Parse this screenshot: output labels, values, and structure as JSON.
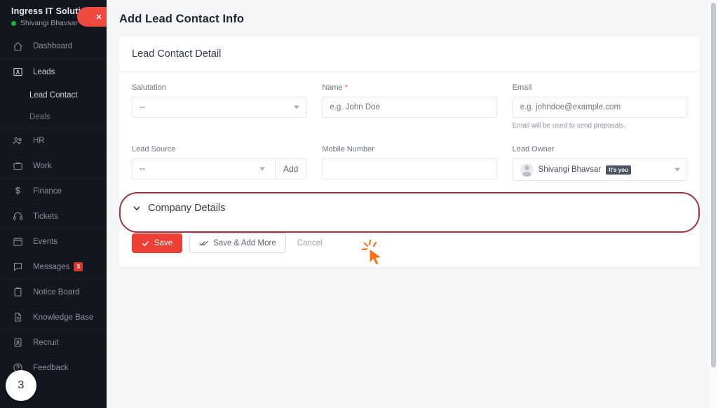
{
  "sidebar": {
    "profile": {
      "company": "Ingress IT Soluti...",
      "user": "Shivangi Bhavsar",
      "status_color": "#17b13f",
      "close_label": "✕",
      "close_color": "#f04a40"
    },
    "items": [
      {
        "label": "Dashboard",
        "icon": "home-icon",
        "active": false
      },
      {
        "label": "Leads",
        "icon": "leads-icon",
        "active": true
      },
      {
        "label": "HR",
        "icon": "hr-icon",
        "active": false
      },
      {
        "label": "Work",
        "icon": "work-icon",
        "active": false
      },
      {
        "label": "Finance",
        "icon": "finance-icon",
        "active": false
      },
      {
        "label": "Tickets",
        "icon": "tickets-icon",
        "active": false
      },
      {
        "label": "Events",
        "icon": "events-icon",
        "active": false
      },
      {
        "label": "Messages",
        "icon": "messages-icon",
        "active": false,
        "badge": "3"
      },
      {
        "label": "Notice Board",
        "icon": "notice-board-icon",
        "active": false
      },
      {
        "label": "Knowledge Base",
        "icon": "knowledge-base-icon",
        "active": false
      },
      {
        "label": "Recruit",
        "icon": "recruit-icon",
        "active": false
      },
      {
        "label": "Feedback",
        "icon": "feedback-icon",
        "active": false
      }
    ],
    "sub_items": [
      {
        "label": "Lead Contact",
        "active": true
      },
      {
        "label": "Deals",
        "active": false
      }
    ],
    "step_badge": "3"
  },
  "header": {
    "title": "Add Lead Contact Info"
  },
  "card": {
    "title": "Lead Contact Detail",
    "fields": {
      "salutation": {
        "label": "Salutation",
        "value": "--",
        "required": false
      },
      "name": {
        "label": "Name",
        "placeholder": "e.g. John Doe",
        "value": "",
        "required": true
      },
      "email": {
        "label": "Email",
        "placeholder": "e.g. johndoe@example.com",
        "value": "",
        "required": false,
        "hint": "Email will be used to send proposals."
      },
      "lead_source": {
        "label": "Lead Source",
        "value": "--",
        "add_label": "Add",
        "required": false
      },
      "mobile_number": {
        "label": "Mobile Number",
        "placeholder": "",
        "value": "",
        "required": false
      },
      "lead_owner": {
        "label": "Lead Owner",
        "value": "Shivangi Bhavsar",
        "tag": "It's you",
        "required": false
      }
    },
    "collapse": {
      "label": "Company Details",
      "expanded": false,
      "highlight_color": "#9e3440"
    },
    "buttons": {
      "save": "Save",
      "save_add_more": "Save & Add More",
      "cancel": "Cancel",
      "save_color": "#ec4037"
    }
  }
}
